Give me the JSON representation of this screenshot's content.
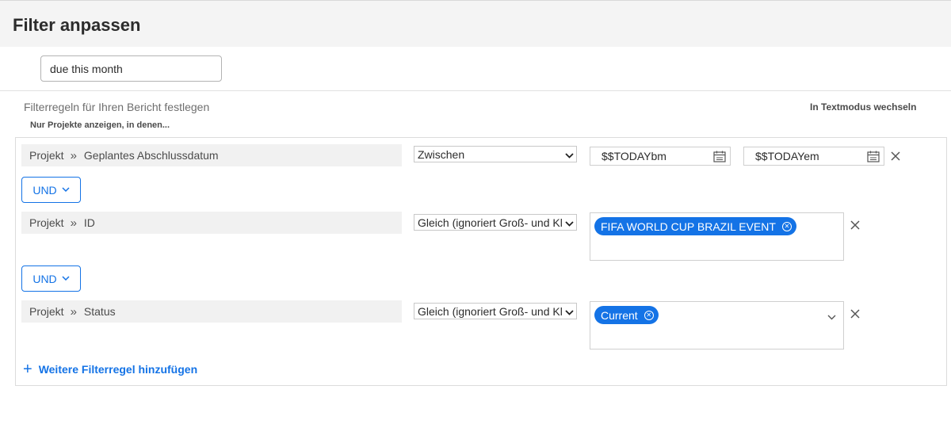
{
  "page": {
    "title": "Filter anpassen",
    "filter_name_value": "due this month"
  },
  "rules_header": {
    "title": "Filterregeln für Ihren Bericht festlegen",
    "subtitle": "Nur Projekte anzeigen, in denen...",
    "text_mode_link": "In Textmodus wechseln"
  },
  "rules": [
    {
      "object": "Projekt",
      "separator": "»",
      "field": "Geplantes Abschlussdatum",
      "operator": "Zwischen",
      "value_from": "$$TODAYbm",
      "value_to": "$$TODAYem"
    },
    {
      "object": "Projekt",
      "separator": "»",
      "field": "ID",
      "operator": "Gleich (ignoriert Groß- und Kleinschreibung)",
      "tags": [
        "FIFA WORLD CUP BRAZIL EVENT"
      ]
    },
    {
      "object": "Projekt",
      "separator": "»",
      "field": "Status",
      "operator": "Gleich (ignoriert Groß- und Kleinschreibung)",
      "tags": [
        "Current"
      ]
    }
  ],
  "connectors": [
    "UND",
    "UND"
  ],
  "add_rule_label": "Weitere Filterregel hinzufügen",
  "colors": {
    "accent": "#1473e6",
    "header_bg": "#f4f4f4",
    "field_bg": "#f1f1f1"
  },
  "icons": {
    "calendar": "calendar-icon",
    "close": "close-icon",
    "chevron": "chevron-down-icon",
    "plus": "plus-icon"
  }
}
